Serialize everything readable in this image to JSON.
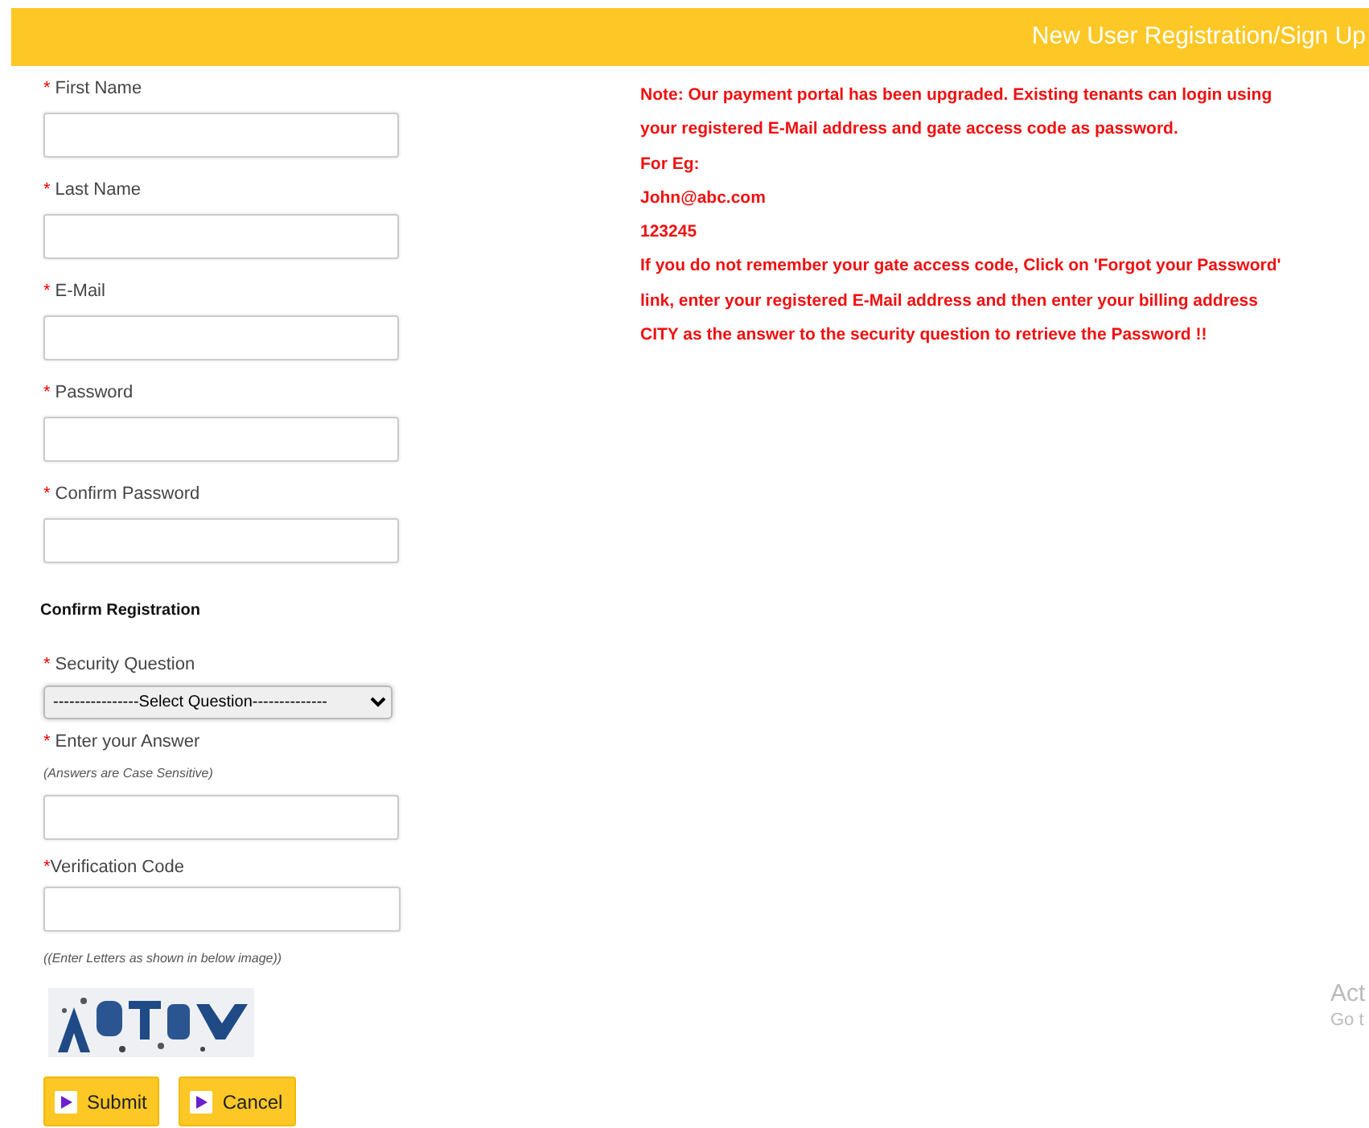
{
  "header": {
    "title": "New User Registration/Sign Up"
  },
  "fields": [
    {
      "label": "First Name",
      "marker": "*"
    },
    {
      "label": "Last Name",
      "marker": "*"
    },
    {
      "label": "E-Mail",
      "marker": "*"
    },
    {
      "label": "Password",
      "marker": "*"
    },
    {
      "label": "Confirm Password",
      "marker": "*"
    }
  ],
  "section_title": "Confirm Registration",
  "security": [
    {
      "label": "Security Question",
      "marker": "*",
      "kind": "select",
      "value": "----------------Select Question--------------"
    },
    {
      "label": "Enter your Answer",
      "marker": "*",
      "kind": "text",
      "hint": "(Answers are Case Sensitive)"
    },
    {
      "label": "Verification Code",
      "marker": "*",
      "kind": "text"
    }
  ],
  "captcha_hint": "((Enter Letters as shown in below image))",
  "captcha": {
    "kind": "picture"
  },
  "buttons": [
    "Submit",
    "Cancel"
  ],
  "note": [
    "Note: Our payment portal has been upgraded. Existing tenants can login using your registered E-Mail address and gate access code as password.",
    "For Eg:",
    "John@abc.com",
    "123245",
    "If you do not remember your gate access code, Click on 'Forgot your Password' link, enter your registered E-Mail address and then enter your billing address CITY as the answer to the security question to retrieve the Password !!"
  ],
  "activation_notice": {
    "title": "Act",
    "subtitle": "Go t"
  }
}
